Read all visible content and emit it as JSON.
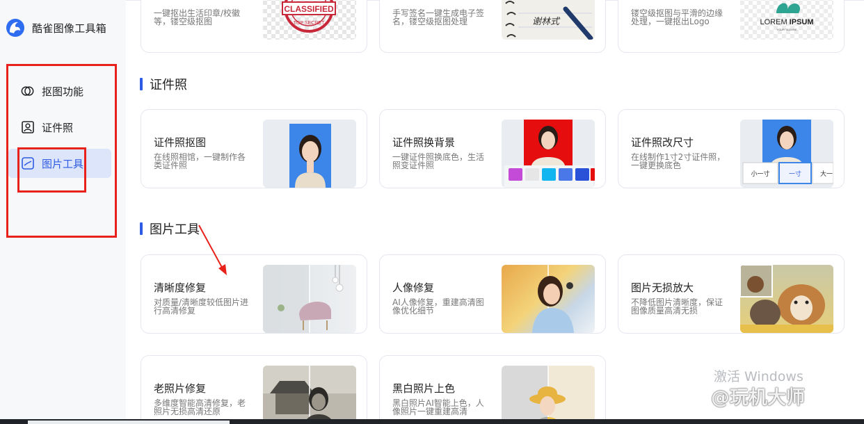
{
  "app": {
    "name": "酷雀图像工具箱"
  },
  "sidebar": {
    "items": [
      {
        "label": "抠图功能"
      },
      {
        "label": "证件照"
      },
      {
        "label": "图片工具"
      }
    ]
  },
  "top_row": [
    {
      "desc": "一键抠出生活印章/校徽等，镂空级抠图",
      "stamp_text": "CLASSIFIED",
      "stamp_sub": "TOP SECRET"
    },
    {
      "desc": "手写签名一键生成电子签名，镂空级抠图处理",
      "sig_text": "谢林式"
    },
    {
      "desc": "镂空级抠图与平滑的边缘处理，一键抠出Logo",
      "logo_text_a": "LOREM ",
      "logo_text_b": "IPSUM",
      "logo_sub": "YOUR TAGLINE"
    }
  ],
  "sections": {
    "id_photo": {
      "title": "证件照",
      "cards": [
        {
          "title": "证件照抠图",
          "desc": "在线照相馆，一键制作各类证件照"
        },
        {
          "title": "证件照换背景",
          "desc": "一键证件照换底色，生活照变证件照"
        },
        {
          "title": "证件照改尺寸",
          "desc": "在线制作1寸2寸证件照，一键更换底色",
          "sizes": [
            "小一寸",
            "一寸",
            "大一"
          ]
        }
      ]
    },
    "image_tools": {
      "title": "图片工具",
      "cards": [
        {
          "title": "清晰度修复",
          "desc": "对质量/清晰度较低图片进行高清修复"
        },
        {
          "title": "人像修复",
          "desc": "AI人像修复，重建高清图像优化细节"
        },
        {
          "title": "图片无损放大",
          "desc": "不降低图片清晰度，保证图像质量高清无损"
        },
        {
          "title": "老照片修复",
          "desc": "多维度智能高清修复，老照片无损高清还原"
        },
        {
          "title": "黑白照片上色",
          "desc": "黑白照片AI智能上色，人像照片一键重建高清"
        }
      ]
    }
  },
  "watermark": {
    "activate": "激活 Windows",
    "handle": "@玩机大师"
  },
  "colors": {
    "accent": "#2d5be3",
    "annotation": "#e8211b"
  }
}
